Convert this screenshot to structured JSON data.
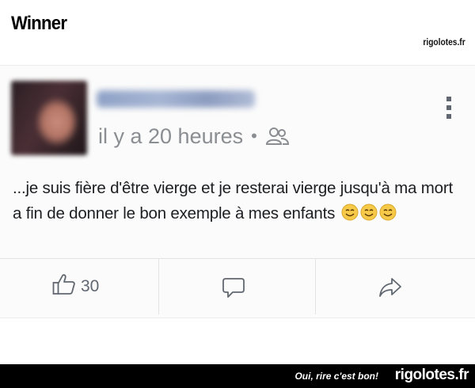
{
  "header": {
    "title": "Winner",
    "brand": "rigolotes.fr"
  },
  "post": {
    "timestamp": "il y a 20 heures",
    "separator": "•",
    "audience_icon": "friends-icon",
    "menu_icon": "more-vertical-icon",
    "text": "...je suis fière d'être vierge et je resterai vierge jusqu'à ma mort a fin de donner le bon exemple à mes enfants",
    "emoji_icons": [
      "smiling-emoji-icon",
      "smiling-emoji-icon",
      "smiling-emoji-icon"
    ]
  },
  "actions": {
    "like_icon": "thumbs-up-icon",
    "like_count": "30",
    "comment_icon": "comment-icon",
    "share_icon": "share-icon"
  },
  "footer": {
    "slogan": "Oui, rire c'est bon!",
    "brand": "rigolotes.fr"
  },
  "colors": {
    "meta_gray": "#8a8d91",
    "text": "#1c1e21",
    "footer_bg": "#000000"
  }
}
